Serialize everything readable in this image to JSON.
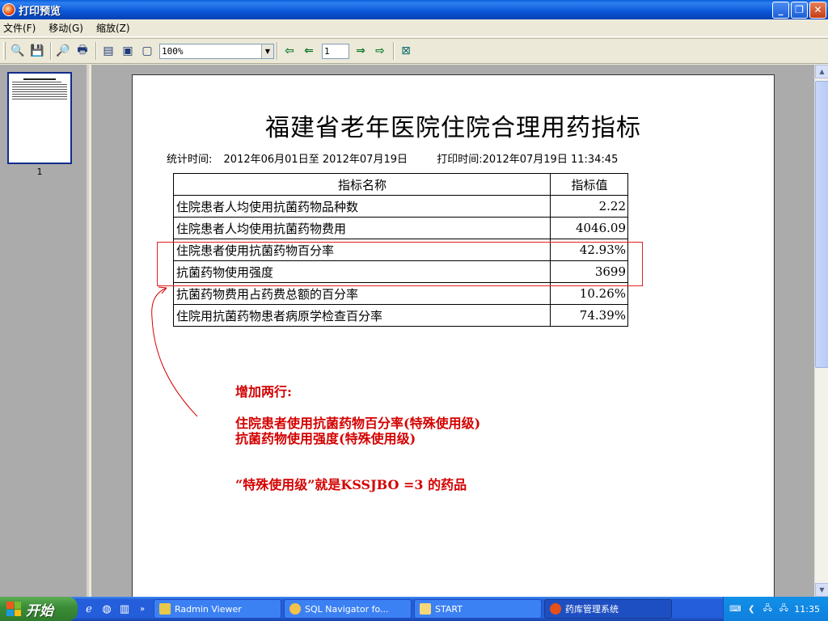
{
  "window": {
    "title": "打印预览"
  },
  "menu": {
    "items": [
      "文件(F)",
      "移动(G)",
      "缩放(Z)"
    ]
  },
  "toolbar": {
    "zoom_value": "100%",
    "page_number": "1"
  },
  "thumbnail": {
    "label": "1"
  },
  "report": {
    "title": "福建省老年医院住院合理用药指标",
    "stat_prefix": "统计时间:",
    "stat_range": "2012年06月01日至 2012年07月19日",
    "print_time": "打印时间:2012年07月19日 11:34:45",
    "headers": [
      "指标名称",
      "指标值"
    ],
    "rows": [
      {
        "name": "住院患者人均使用抗菌药物品种数",
        "value": "2.22"
      },
      {
        "name": "住院患者人均使用抗菌药物费用",
        "value": "4046.09"
      },
      {
        "name": "住院患者使用抗菌药物百分率",
        "value": "42.93%"
      },
      {
        "name": "抗菌药物使用强度",
        "value": "3699"
      },
      {
        "name": "抗菌药物费用占药费总额的百分率",
        "value": "10.26%"
      },
      {
        "name": "住院用抗菌药物患者病原学检查百分率",
        "value": "74.39%"
      }
    ]
  },
  "annotation": {
    "heading": "增加两行:",
    "line1": "住院患者使用抗菌药物百分率(特殊使用级)",
    "line2": "抗菌药物使用强度(特殊使用级)",
    "line3": "“特殊使用级”就是KSSJBO =3 的药品",
    "color": "#d40000"
  },
  "taskbar": {
    "start_label": "开始",
    "tasks": [
      {
        "label": "Radmin Viewer"
      },
      {
        "label": "SQL Navigator fo..."
      },
      {
        "label": "START"
      },
      {
        "label": "药库管理系统"
      }
    ],
    "clock": "11:35"
  }
}
